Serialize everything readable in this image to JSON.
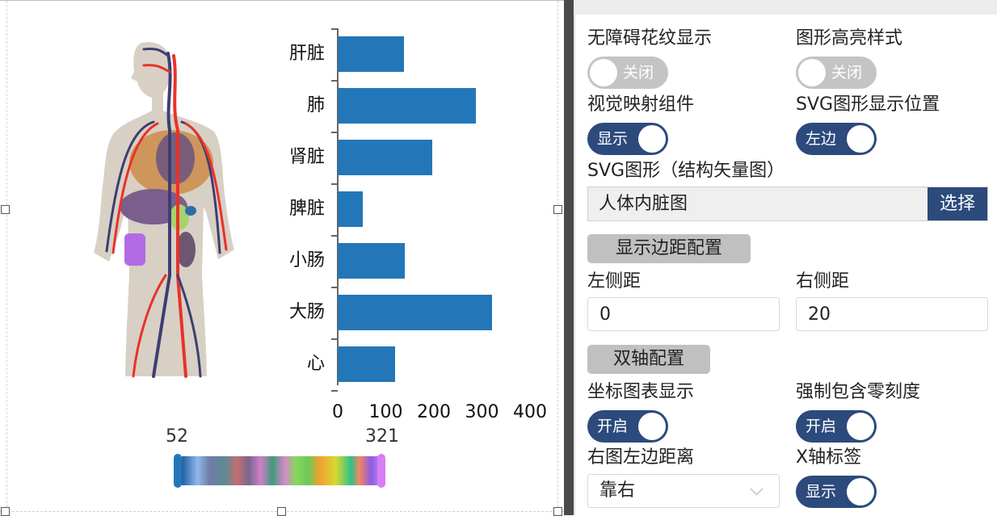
{
  "chart_data": {
    "type": "bar",
    "orientation": "horizontal",
    "categories": [
      "肝脏",
      "肺",
      "肾脏",
      "脾脏",
      "小肠",
      "大肠",
      "心"
    ],
    "values": [
      137,
      287,
      197,
      52,
      139,
      321,
      119
    ],
    "xticks": [
      "0",
      "100",
      "200",
      "300",
      "400"
    ],
    "xlim": [
      0,
      400
    ],
    "bar_color": "#2377b8",
    "title": "",
    "xlabel": "",
    "ylabel": "",
    "grid": false
  },
  "visual_map": {
    "min_label": "52",
    "max_label": "321",
    "min_handle_color": "#2377b8",
    "max_handle_color": "#d77ef2"
  },
  "illustration": {
    "name": "人体内脏图"
  },
  "panel": {
    "accessible_pattern": {
      "label": "无障碍花纹显示",
      "state": "关闭",
      "on": false
    },
    "highlight_style": {
      "label": "图形高亮样式",
      "state": "关闭",
      "on": false
    },
    "visual_map_component": {
      "label": "视觉映射组件",
      "state": "显示",
      "on": true
    },
    "svg_position": {
      "label": "SVG图形显示位置",
      "state": "左边",
      "on": true
    },
    "svg_graphic": {
      "label": "SVG图形（结构矢量图）",
      "value": "人体内脏图",
      "button": "选择"
    },
    "margin_section": {
      "label": "显示边距配置"
    },
    "left_margin": {
      "label": "左侧距",
      "value": "0"
    },
    "right_margin": {
      "label": "右侧距",
      "value": "20"
    },
    "dual_axis_section": {
      "label": "双轴配置"
    },
    "coord_chart": {
      "label": "坐标图表显示",
      "state": "开启",
      "on": true
    },
    "force_zero": {
      "label": "强制包含零刻度",
      "state": "开启",
      "on": true
    },
    "right_chart_left_distance": {
      "label": "右图左边距离",
      "value": "靠右"
    },
    "x_axis_label": {
      "label": "X轴标签",
      "state": "显示",
      "on": true
    }
  },
  "colors": {
    "accent": "#2c4a7c",
    "toggle_off": "#c4c4c4",
    "section_button": "#c0c0c0"
  }
}
